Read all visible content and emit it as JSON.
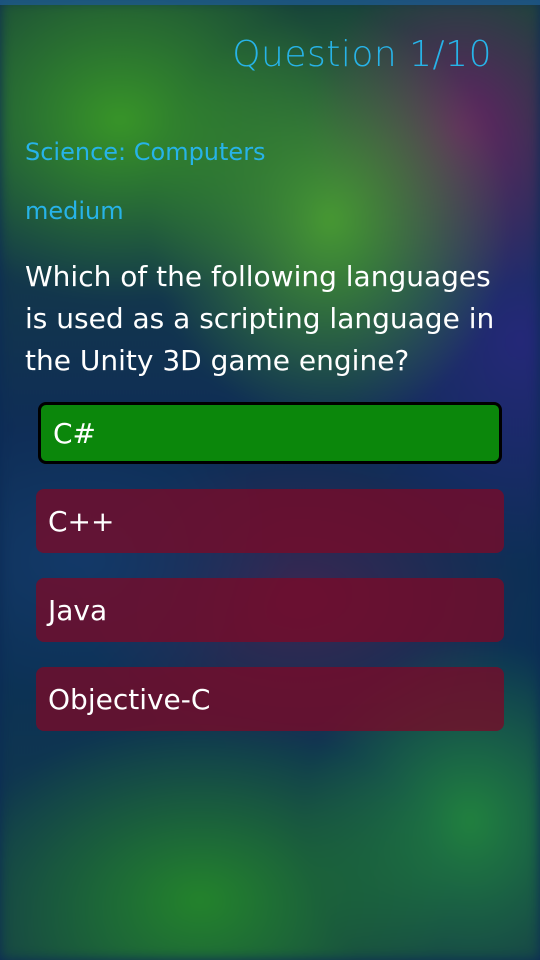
{
  "header": {
    "title": "Question 1/10"
  },
  "question": {
    "category": "Science: Computers",
    "difficulty": "medium",
    "text": "Which of the following languages is used as a scripting language in the Unity 3D game engine?"
  },
  "answers": [
    {
      "label": "C#",
      "state": "correct"
    },
    {
      "label": "C++",
      "state": "wrong"
    },
    {
      "label": "Java",
      "state": "wrong"
    },
    {
      "label": "Objective-C",
      "state": "wrong"
    }
  ],
  "colors": {
    "accent": "#27b3e8",
    "correct": "#0b870b",
    "wrong": "#7a0a28",
    "text": "#ffffff"
  }
}
